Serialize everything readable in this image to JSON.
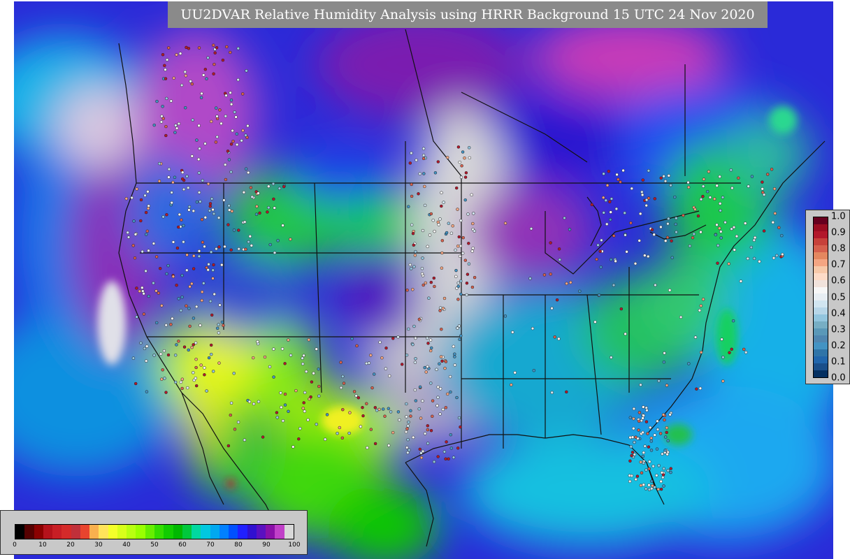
{
  "title": "UU2DVAR Relative Humidity Analysis using HRRR Background 15 UTC 24 Nov 2020",
  "rh_colorbar": {
    "ticks": [
      "0",
      "10",
      "20",
      "30",
      "40",
      "50",
      "60",
      "70",
      "80",
      "90",
      "100"
    ],
    "colors": [
      "#000000",
      "#550000",
      "#8b0000",
      "#b5121b",
      "#c81e25",
      "#d42a2a",
      "#c0303a",
      "#e8442e",
      "#f9b04e",
      "#ffe35a",
      "#f4ff2a",
      "#d8ff1a",
      "#b8ff10",
      "#99ff00",
      "#66ee00",
      "#33dd00",
      "#11cc00",
      "#00b800",
      "#00c83c",
      "#00d8a0",
      "#00c8e0",
      "#00a8f0",
      "#0080ff",
      "#0050ff",
      "#2020ff",
      "#3010d0",
      "#5a10c0",
      "#8a10a8",
      "#c040c8",
      "#d8d8d8"
    ]
  },
  "ob_colorbar": {
    "ticks": [
      "1.0",
      "0.9",
      "0.8",
      "0.7",
      "0.6",
      "0.5",
      "0.4",
      "0.3",
      "0.2",
      "0.1",
      "0.0"
    ],
    "colors": [
      "#67001f",
      "#9b0d22",
      "#b2182b",
      "#c7413a",
      "#d6604d",
      "#e4875f",
      "#f4a582",
      "#f7c9a9",
      "#fddbc7",
      "#f1e3dc",
      "#f7f7f7",
      "#e8eef3",
      "#d1e5f0",
      "#b7d6e8",
      "#92c5de",
      "#77aec4",
      "#5a98b8",
      "#4f86b0",
      "#4393c3",
      "#2f74a8",
      "#2166ac",
      "#1a4f8a",
      "#053061"
    ]
  }
}
